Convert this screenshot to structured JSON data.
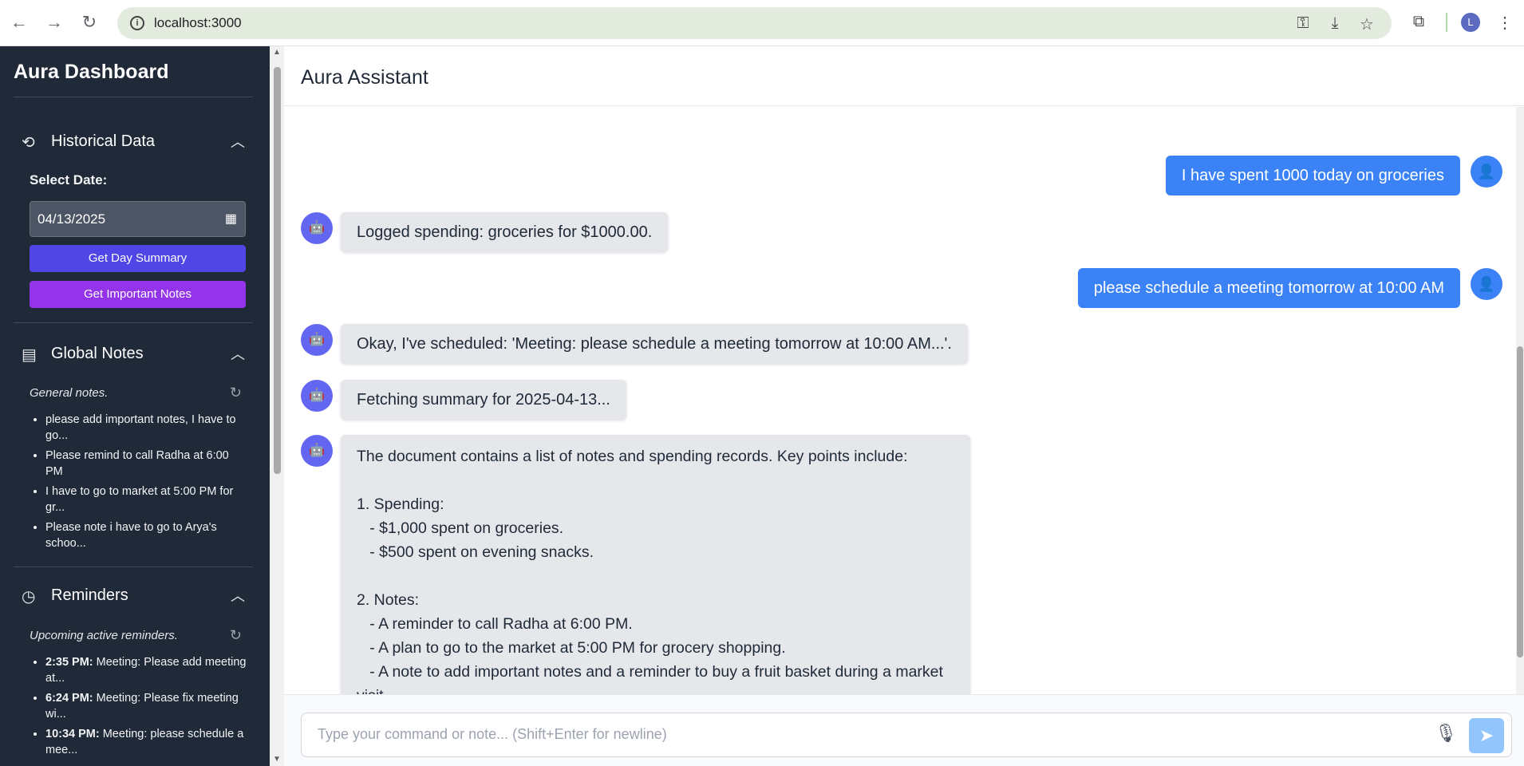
{
  "browser": {
    "url": "localhost:3000",
    "profile_initial": "L"
  },
  "sidebar": {
    "title": "Aura Dashboard",
    "historical": {
      "label": "Historical Data",
      "select_date_label": "Select Date:",
      "date_value": "04/13/2025",
      "day_summary_button": "Get Day Summary",
      "important_notes_button": "Get Important Notes"
    },
    "global_notes": {
      "label": "Global Notes",
      "subtitle": "General notes.",
      "items": [
        "please add important notes, I have to go...",
        "Please remind to call Radha at 6:00 PM",
        "I have to go to market at 5:00 PM for gr...",
        "Please note i have to go to Arya's schoo..."
      ]
    },
    "reminders": {
      "label": "Reminders",
      "subtitle": "Upcoming active reminders.",
      "items": [
        {
          "time": "2:35 PM:",
          "text": " Meeting: Please add meeting at..."
        },
        {
          "time": "6:24 PM:",
          "text": " Meeting: Please fix meeting wi..."
        },
        {
          "time": "10:34 PM:",
          "text": " Meeting: please schedule a mee..."
        }
      ]
    }
  },
  "main": {
    "title": "Aura Assistant",
    "messages": [
      {
        "role": "user",
        "text": "I have spent 1000 today on groceries"
      },
      {
        "role": "bot",
        "text": "Logged spending: groceries for $1000.00."
      },
      {
        "role": "user",
        "text": "please schedule a meeting tomorrow at 10:00 AM"
      },
      {
        "role": "bot",
        "text": "Okay, I've scheduled: 'Meeting: please schedule a meeting tomorrow at 10:00 AM...'."
      },
      {
        "role": "bot",
        "text": "Fetching summary for 2025-04-13..."
      },
      {
        "role": "bot",
        "text": "The document contains a list of notes and spending records. Key points include:\n\n1. Spending:\n   - $1,000 spent on groceries.\n   - $500 spent on evening snacks.\n\n2. Notes:\n   - A reminder to call Radha at 6:00 PM.\n   - A plan to go to the market at 5:00 PM for grocery shopping.\n   - A note to add important notes and a reminder to buy a fruit basket during a market visit.\n   - A reminder to visit Arya's school on Saturday."
      }
    ],
    "input_placeholder": "Type your command or note... (Shift+Enter for newline)"
  },
  "colors": {
    "sidebar_bg": "#1f2937",
    "user_bubble": "#3b82f6",
    "bot_bubble": "#e5e7eb",
    "bot_avatar": "#6366f1",
    "summary_button": "#4f46e5",
    "notes_button": "#9333ea"
  }
}
